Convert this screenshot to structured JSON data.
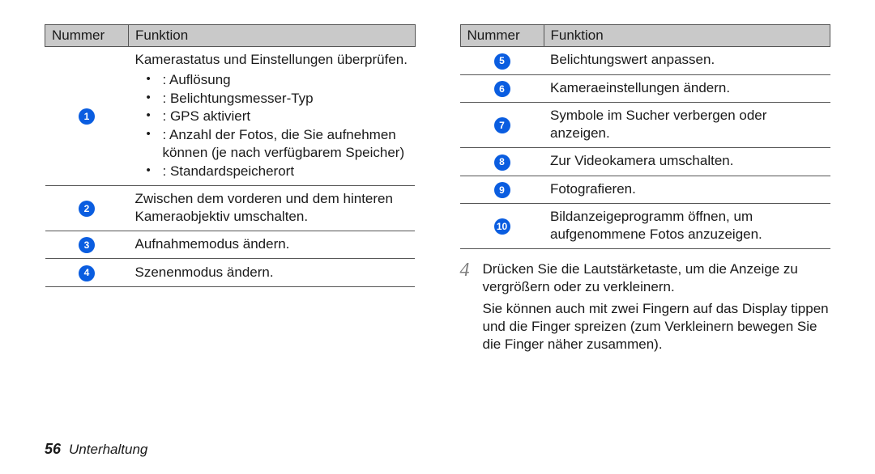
{
  "headers": {
    "nummer": "Nummer",
    "funktion": "Funktion"
  },
  "left": {
    "row1": {
      "num": "1",
      "intro": "Kamerastatus und Einstellungen überprüfen.",
      "bullets": [
        " : Auflösung",
        " : Belichtungsmesser-Typ",
        " : GPS aktiviert",
        " : Anzahl der Fotos, die Sie aufnehmen können (je nach verfügbarem Speicher)",
        " : Standardspeicherort"
      ]
    },
    "row2": {
      "num": "2",
      "text": "Zwischen dem vorderen und dem hinteren Kameraobjektiv umschalten."
    },
    "row3": {
      "num": "3",
      "text": "Aufnahmemodus ändern."
    },
    "row4": {
      "num": "4",
      "text": "Szenenmodus ändern."
    }
  },
  "right": {
    "row5": {
      "num": "5",
      "text": "Belichtungswert anpassen."
    },
    "row6": {
      "num": "6",
      "text": "Kameraeinstellungen ändern."
    },
    "row7": {
      "num": "7",
      "text": "Symbole im Sucher verbergen oder anzeigen."
    },
    "row8": {
      "num": "8",
      "text": "Zur Videokamera umschalten."
    },
    "row9": {
      "num": "9",
      "text": "Fotografieren."
    },
    "row10": {
      "num": "10",
      "text": "Bildanzeigeprogramm öffnen, um aufgenommene Fotos anzuzeigen."
    }
  },
  "step4": {
    "num": "4",
    "p1": "Drücken Sie die Lautstärketaste, um die Anzeige zu vergrößern oder zu verkleinern.",
    "p2": "Sie können auch mit zwei Fingern auf das Display tippen und die Finger spreizen (zum Verkleinern bewegen Sie die Finger näher zusammen)."
  },
  "footer": {
    "page": "56",
    "section": "Unterhaltung"
  }
}
